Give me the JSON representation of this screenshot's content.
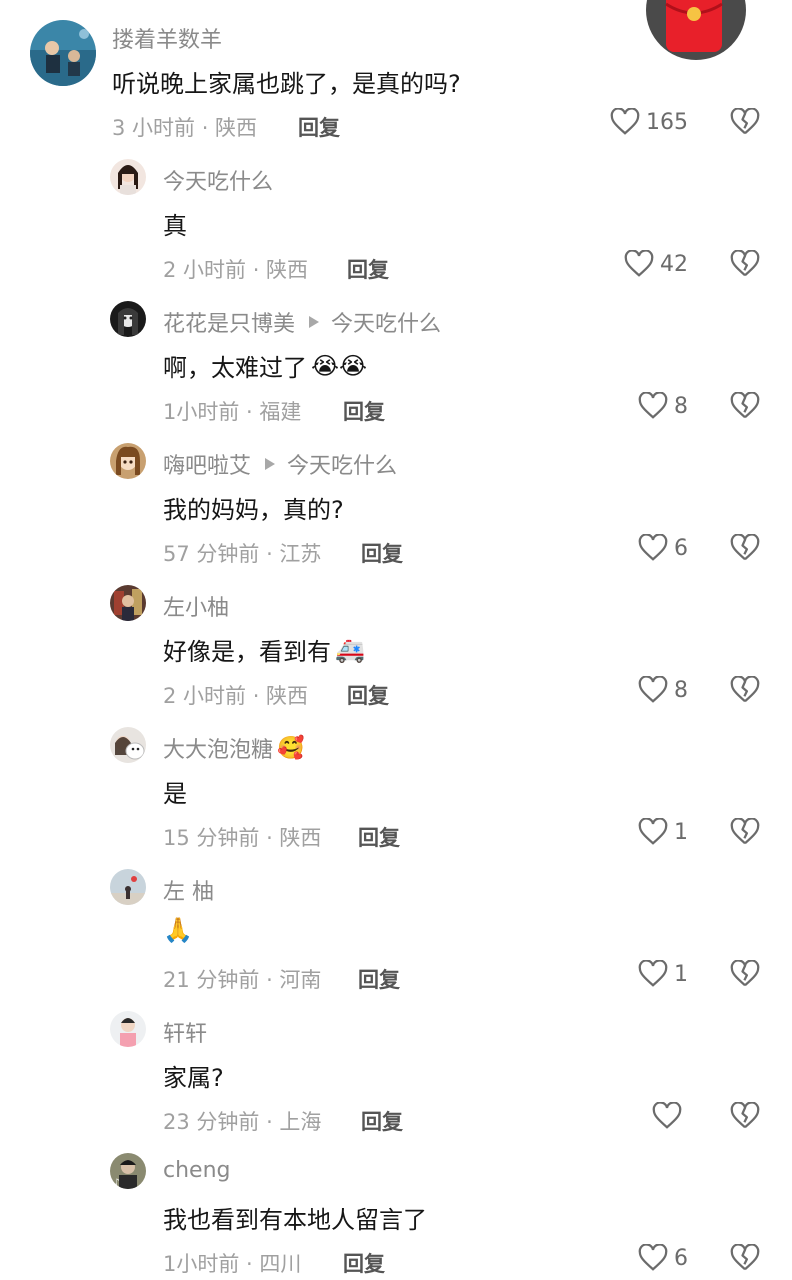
{
  "top_comment": {
    "username": "搂着羊数羊",
    "text": "听说晚上家属也跳了，是真的吗?",
    "meta": "3 小时前 · 陕西",
    "reply_label": "回复",
    "likes": "165"
  },
  "replies": [
    {
      "username": "今天吃什么",
      "reply_to": "",
      "text": "真",
      "emoji": "",
      "meta": "2 小时前 · 陕西",
      "reply_label": "回复",
      "likes": "42"
    },
    {
      "username": "花花是只博美",
      "reply_to": "今天吃什么",
      "text": "啊，太难过了",
      "emoji": "😭😭",
      "meta": "1小时前 · 福建",
      "reply_label": "回复",
      "likes": "8"
    },
    {
      "username": "嗨吧啦艾",
      "reply_to": "今天吃什么",
      "text": "我的妈妈，真的?",
      "emoji": "",
      "meta": "57 分钟前 · 江苏",
      "reply_label": "回复",
      "likes": "6"
    },
    {
      "username": "左小柚",
      "reply_to": "",
      "text": "好像是，看到有",
      "emoji": "🚑",
      "meta": "2 小时前 · 陕西",
      "reply_label": "回复",
      "likes": "8"
    },
    {
      "username": "大大泡泡糖",
      "name_emoji": "🥰",
      "reply_to": "",
      "text": "是",
      "emoji": "",
      "meta": "15 分钟前 · 陕西",
      "reply_label": "回复",
      "likes": "1"
    },
    {
      "username": "左 柚",
      "reply_to": "",
      "text": "",
      "emoji": "🙏",
      "meta": "21 分钟前 · 河南",
      "reply_label": "回复",
      "likes": "1"
    },
    {
      "username": "轩轩",
      "reply_to": "",
      "text": "家属?",
      "emoji": "",
      "meta": "23 分钟前 · 上海",
      "reply_label": "回复",
      "likes": ""
    },
    {
      "username": "cheng",
      "reply_to": "",
      "text": "我也看到有本地人留言了",
      "emoji": "",
      "meta": "1小时前 · 四川",
      "reply_label": "回复",
      "likes": "6"
    }
  ],
  "colors": {
    "accent_red": "#e8202a",
    "text": "#161616",
    "muted": "#a0a0a0"
  }
}
